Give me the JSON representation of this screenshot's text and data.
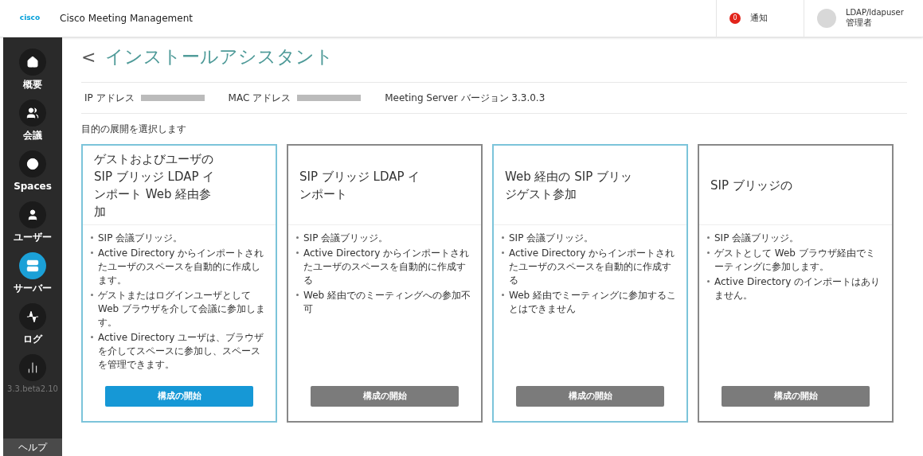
{
  "header": {
    "logo": "cisco",
    "app_title": "Cisco Meeting Management",
    "notifications": {
      "count": "0",
      "label": "通知"
    },
    "user": {
      "name": "LDAP/ldapuser",
      "role": "管理者"
    }
  },
  "sidebar": {
    "items": [
      {
        "label": "概要",
        "selected": false
      },
      {
        "label": "会議",
        "selected": false
      },
      {
        "label": "Spaces",
        "selected": false
      },
      {
        "label": "ユーザー",
        "selected": false
      },
      {
        "label": "サーバー",
        "selected": true
      },
      {
        "label": "ログ",
        "selected": false
      },
      {
        "label": "3.3.beta2.10",
        "selected": false
      }
    ],
    "help": "ヘルプ"
  },
  "page": {
    "back": "<",
    "title": "インストールアシスタント"
  },
  "info": [
    {
      "label": "IP アドレス",
      "redacted": true
    },
    {
      "label": "MAC アドレス",
      "redacted": true
    },
    {
      "label": "Meeting Server バージョン 3.3.0.3",
      "redacted": false
    }
  ],
  "prompt": "目的の展開を選択します",
  "cards": [
    {
      "title": "ゲストおよびユーザの SIP ブリッジ LDAP インポート Web 経由参加",
      "highlighted": true,
      "bullets": [
        "SIP 会議ブリッジ。",
        "Active Directory からインポートされたユーザのスペースを自動的に作成します。",
        "ゲストまたはログインユーザとして Web ブラウザを介して会議に参加します。",
        "Active Directory ユーザは、ブラウザを介してスペースに参加し、スペースを管理できます。"
      ],
      "button": {
        "label": "構成の開始",
        "primary": true
      }
    },
    {
      "title": "SIP ブリッジ LDAP インポート",
      "highlighted": false,
      "bullets": [
        "SIP 会議ブリッジ。",
        "Active Directory からインポートされたユーザのスペースを自動的に作成する",
        "Web 経由でのミーティングへの参加不可"
      ],
      "button": {
        "label": "構成の開始",
        "primary": false
      }
    },
    {
      "title": "Web 経由の SIP ブリッジゲスト参加",
      "highlighted": true,
      "bullets": [
        "SIP 会議ブリッジ。",
        "Active Directory からインポートされたユーザのスペースを自動的に作成する",
        "Web 経由でミーティングに参加することはできません"
      ],
      "button": {
        "label": "構成の開始",
        "primary": false
      }
    },
    {
      "title": "SIP ブリッジの",
      "highlighted": false,
      "bullets": [
        "SIP 会議ブリッジ。",
        "ゲストとして Web ブラウザ経由でミーティングに参加します。",
        "Active Directory のインポートはありません。"
      ],
      "button": {
        "label": "構成の開始",
        "primary": false
      }
    }
  ]
}
